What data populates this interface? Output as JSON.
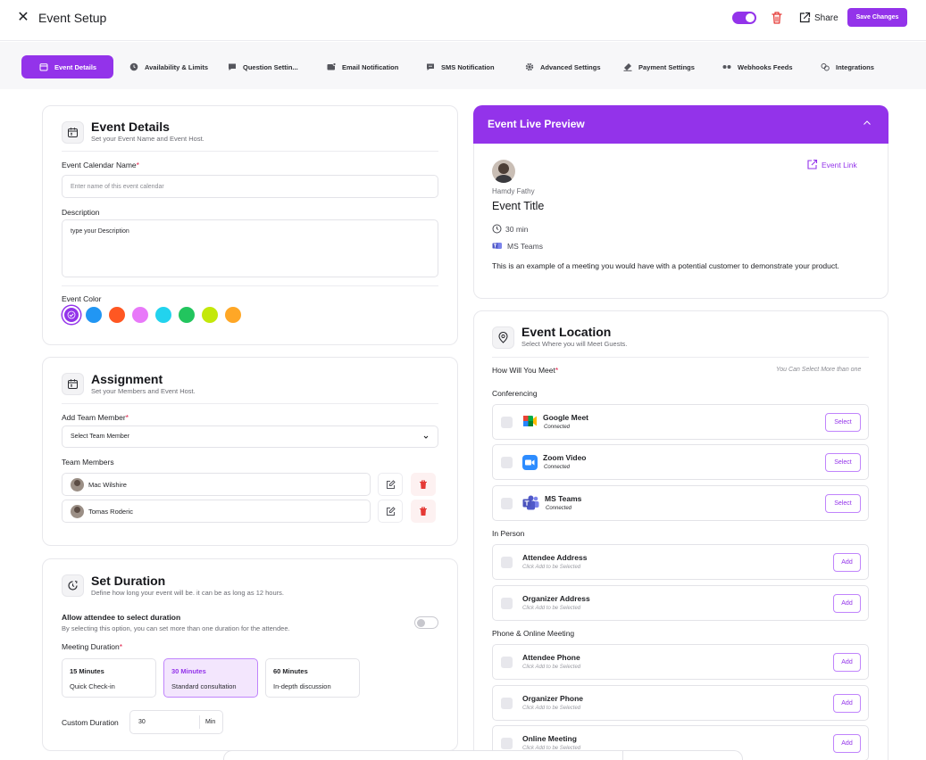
{
  "header": {
    "title": "Event Setup",
    "share_label": "Share",
    "save_label": "Save Changes"
  },
  "tabs": [
    {
      "label": "Event Details",
      "icon": "calendar-icon",
      "active": true
    },
    {
      "label": "Availability & Limits",
      "icon": "clock-icon"
    },
    {
      "label": "Question Settin...",
      "icon": "question-icon"
    },
    {
      "label": "Email Notification",
      "icon": "email-icon"
    },
    {
      "label": "SMS Notification",
      "icon": "sms-icon"
    },
    {
      "label": "Advanced Settings",
      "icon": "gear-icon"
    },
    {
      "label": "Payment Settings",
      "icon": "payment-icon"
    },
    {
      "label": "Webhooks Feeds",
      "icon": "webhook-icon"
    },
    {
      "label": "Integrations",
      "icon": "integrations-icon"
    }
  ],
  "details": {
    "title": "Event Details",
    "subtitle": "Set your Event Name and Event Host.",
    "name_label": "Event Calendar Name",
    "name_placeholder": "Enter name of this event calendar",
    "desc_label": "Description",
    "desc_value": "type your Description",
    "color_label": "Event Color",
    "colors": [
      "#9333ea",
      "#2196f3",
      "#ff5722",
      "#e879f9",
      "#22d3ee",
      "#22c55e",
      "#c3e80a",
      "#ffa726"
    ]
  },
  "assignment": {
    "title": "Assignment",
    "subtitle": "Set your Members and Event Host.",
    "add_label": "Add Team Member",
    "select_value": "Select Team Member",
    "members_label": "Team Members",
    "members": [
      "Mac Wilshire",
      "Tomas Roderic"
    ]
  },
  "duration": {
    "title": "Set Duration",
    "subtitle": "Define how long your event will be. it can be as long as 12 hours.",
    "allow_title": "Allow attendee to select duration",
    "allow_desc": "By selecting this option, you can set more than one duration for the attendee.",
    "meeting_label": "Meeting Duration",
    "options": [
      {
        "title": "15 Minutes",
        "desc": "Quick Check-in"
      },
      {
        "title": "30 Minutes",
        "desc": "Standard consultation"
      },
      {
        "title": "60 Minutes",
        "desc": "In-depth discussion"
      }
    ],
    "custom_label": "Custom Duration",
    "custom_value": "30",
    "custom_unit": "Min"
  },
  "preview": {
    "title": "Event Live Preview",
    "link_label": "Event Link",
    "host": "Hamdy Fathy",
    "event_title": "Event Title",
    "duration": "30 min",
    "platform": "MS Teams",
    "description": "This is an example of a meeting you would have with a potential customer to demonstrate your product."
  },
  "location": {
    "title": "Event Location",
    "subtitle": "Select Where you will Meet Guests.",
    "how_label": "How Will You Meet",
    "hint": "You Can Select More than one",
    "groups": {
      "conferencing": "Conferencing",
      "in_person": "In Person",
      "phone_online": "Phone & Online Meeting"
    },
    "conferencing": [
      {
        "name": "Google Meet",
        "status": "Connected",
        "action": "Select"
      },
      {
        "name": "Zoom Video",
        "status": "Connected",
        "action": "Select"
      },
      {
        "name": "MS Teams",
        "status": "Connected",
        "action": "Select"
      }
    ],
    "in_person": [
      {
        "name": "Attendee Address",
        "status": "Click Add to be Selected",
        "action": "Add"
      },
      {
        "name": "Organizer Address",
        "status": "Click Add to be Selected",
        "action": "Add"
      }
    ],
    "phone_online": [
      {
        "name": "Attendee Phone",
        "status": "Click Add to be Selected",
        "action": "Add"
      },
      {
        "name": "Organizer Phone",
        "status": "Click Add to be Selected",
        "action": "Add"
      },
      {
        "name": "Online Meeting",
        "status": "Click Add to be Selected",
        "action": "Add"
      }
    ]
  }
}
